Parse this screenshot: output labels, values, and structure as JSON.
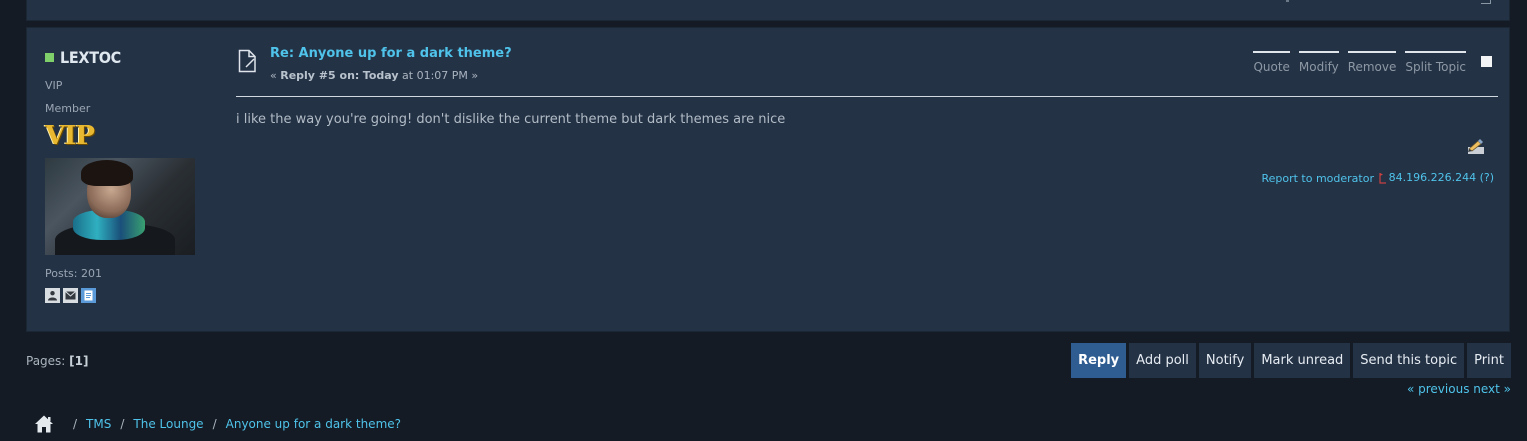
{
  "post": {
    "poster": {
      "name": "LEXTOC",
      "group": "VIP",
      "rank": "Member",
      "badge": "VIP",
      "posts": "Posts: 201"
    },
    "title": "Re: Anyone up for a dark theme?",
    "meta_prefix": "« ",
    "meta_reply": "Reply #5 on:",
    "meta_day": "Today",
    "meta_time": " at 01:07 PM »",
    "quickbuttons": [
      "Quote",
      "Modify",
      "Remove",
      "Split Topic"
    ],
    "body": "i like the way you're going! don't dislike the current theme but dark themes are nice",
    "report_label": "Report to moderator",
    "ip": "84.196.226.244 (?)"
  },
  "pagination": {
    "label": "Pages: ",
    "current": "[1]",
    "prevnext": "« previous next »"
  },
  "buttons": [
    "Reply",
    "Add poll",
    "Notify",
    "Mark unread",
    "Send this topic",
    "Print"
  ],
  "breadcrumb": {
    "separator": "/",
    "items": [
      "TMS",
      "The Lounge",
      "Anyone up for a dark theme?"
    ]
  },
  "icons": {
    "online": "online-status-icon",
    "profile": "profile-icon",
    "email": "email-icon",
    "personal_message": "personal-message-icon",
    "post": "post-document-icon",
    "edit": "edit-pencil-icon",
    "ip": "ip-flag-icon",
    "home": "home-icon"
  },
  "colors": {
    "link": "#4fc3ea",
    "panel": "#243246",
    "background": "#141b24",
    "active_button": "#2f5d92",
    "online": "#7fcf6a"
  }
}
